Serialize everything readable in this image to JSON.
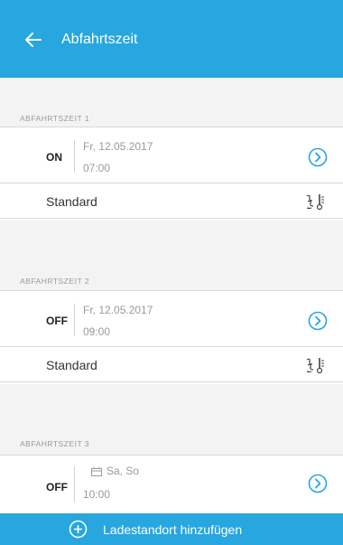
{
  "header": {
    "title": "Abfahrtszeit"
  },
  "departures": [
    {
      "section_label": "ABFAHRTSZEIT 1",
      "state": "ON",
      "date": "Fr, 12.05.2017",
      "time": "07:00",
      "profile": "Standard"
    },
    {
      "section_label": "ABFAHRTSZEIT 2",
      "state": "OFF",
      "date": "Fr, 12.05.2017",
      "time": "09:00",
      "profile": "Standard"
    },
    {
      "section_label": "ABFAHRTSZEIT 3",
      "state": "OFF",
      "date": "Sa, So",
      "time": "10:00"
    }
  ],
  "footer": {
    "add_label": "Ladestandort hinzufügen"
  },
  "colors": {
    "accent": "#27a6df",
    "chevron": "#27a6df"
  }
}
